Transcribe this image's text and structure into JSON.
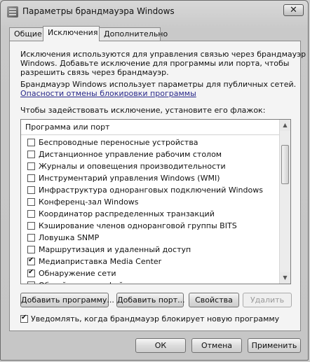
{
  "window": {
    "title": "Параметры брандмауэра Windows",
    "close_glyph": "✕"
  },
  "tabs": [
    {
      "label": "Общие"
    },
    {
      "label": "Исключения"
    },
    {
      "label": "Дополнительно"
    }
  ],
  "content": {
    "description": [
      "Исключения используются для управления связью через брандмауэр",
      "Windows. Добавьте исключение для программы или порта, чтобы",
      "разрешить связь через брандмауэр."
    ],
    "profile_text": "Брандмауэр Windows использует параметры для публичных сетей.",
    "risk_link": "Опасности отмены блокировки программы",
    "instruction": "Чтобы задействовать исключение, установите его флажок:"
  },
  "list": {
    "header": "Программа или порт",
    "items": [
      {
        "label": "Беспроводные переносные устройства",
        "checked": false
      },
      {
        "label": "Дистанционное управление рабочим столом",
        "checked": false
      },
      {
        "label": "Журналы и оповещения производительности",
        "checked": false
      },
      {
        "label": "Инструментарий управления Windows (WMI)",
        "checked": false
      },
      {
        "label": "Инфраструктура одноранговых подключений Windows",
        "checked": false
      },
      {
        "label": "Конференц-зал Windows",
        "checked": false
      },
      {
        "label": "Координатор распределенных транзакций",
        "checked": false
      },
      {
        "label": "Кэширование членов одноранговой группы BITS",
        "checked": false
      },
      {
        "label": "Ловушка SNMP",
        "checked": false
      },
      {
        "label": "Маршрутизация и удаленный доступ",
        "checked": false
      },
      {
        "label": "Медиаприставка Media Center",
        "checked": true
      },
      {
        "label": "Обнаружение сети",
        "checked": true
      },
      {
        "label": "Общий доступ к файлам и принтерам",
        "checked": false
      }
    ]
  },
  "buttons": {
    "add_program": "Добавить программу...",
    "add_port": "Добавить порт...",
    "properties": "Свойства",
    "delete": "Удалить"
  },
  "notify": {
    "label": "Уведомлять, когда брандмауэр блокирует новую программу",
    "checked": true
  },
  "footer": {
    "ok": "ОК",
    "cancel": "Отмена",
    "apply": "Применить"
  }
}
